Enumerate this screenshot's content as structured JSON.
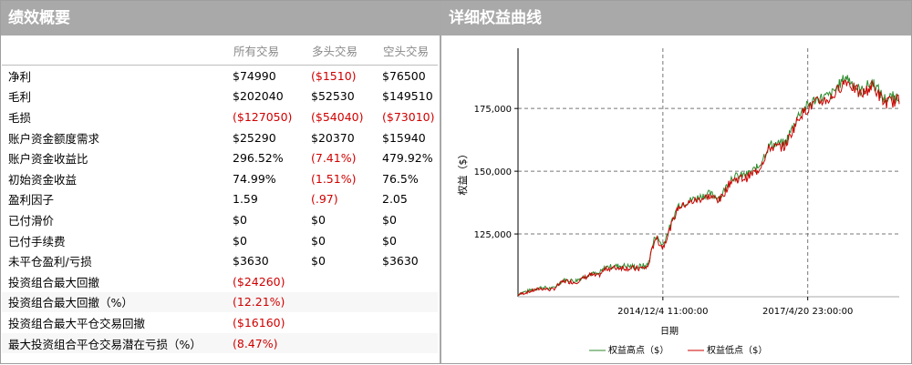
{
  "summary": {
    "title": "绩效概要",
    "columns": [
      "所有交易",
      "多头交易",
      "空头交易"
    ],
    "rows": [
      {
        "label": "净利",
        "values": [
          "$74990",
          "($1510)",
          "$76500"
        ]
      },
      {
        "label": "毛利",
        "values": [
          "$202040",
          "$52530",
          "$149510"
        ]
      },
      {
        "label": "毛损",
        "values": [
          "($127050)",
          "($54040)",
          "($73010)"
        ]
      },
      {
        "label": "账户资金额度需求",
        "values": [
          "$25290",
          "$20370",
          "$15940"
        ]
      },
      {
        "label": "账户资金收益比",
        "values": [
          "296.52%",
          "(7.41%)",
          "479.92%"
        ]
      },
      {
        "label": "初始资金收益",
        "values": [
          "74.99%",
          "(1.51%)",
          "76.5%"
        ]
      },
      {
        "label": "盈利因子",
        "values": [
          "1.59",
          "(.97)",
          "2.05"
        ]
      },
      {
        "label": "已付滑价",
        "values": [
          "$0",
          "$0",
          "$0"
        ]
      },
      {
        "label": "已付手续费",
        "values": [
          "$0",
          "$0",
          "$0"
        ]
      },
      {
        "label": "未平仓盈利/亏损",
        "values": [
          "$3630",
          "$0",
          "$3630"
        ]
      },
      {
        "label": "投资组合最大回撤",
        "values": [
          "($24260)",
          "",
          ""
        ]
      },
      {
        "label": "投资组合最大回撤（%）",
        "values": [
          "(12.21%)",
          "",
          ""
        ]
      },
      {
        "label": "投资组合最大平仓交易回撤",
        "values": [
          "($16160)",
          "",
          ""
        ]
      },
      {
        "label": "最大投资组合平仓交易潜在亏损（%）",
        "values": [
          "(8.47%)",
          "",
          ""
        ]
      }
    ]
  },
  "colors": {
    "negative": "#d00000",
    "header_bg": "#a9a9a9",
    "series_high": "#2e8b2e",
    "series_low": "#cc0000"
  },
  "chart_data": {
    "type": "line",
    "title": "详细权益曲线",
    "xlabel": "日期",
    "ylabel": "权益（$）",
    "x_ticks": [
      "2014/12/4 11:00:00",
      "2017/4/20 23:00:00"
    ],
    "y_ticks": [
      "125,000",
      "150,000",
      "175,000"
    ],
    "ylim": [
      100000,
      199000
    ],
    "grid": true,
    "legend_position": "bottom-center",
    "series": [
      {
        "name": "权益高点（$）",
        "color": "#2e8b2e"
      },
      {
        "name": "权益低点（$）",
        "color": "#cc0000"
      }
    ],
    "x_index": [
      0,
      6,
      9,
      12,
      15,
      19,
      21,
      23,
      27,
      31,
      34,
      36,
      38,
      42,
      46,
      50,
      53,
      56,
      60,
      63,
      66,
      70,
      74,
      78,
      82,
      86,
      90,
      93,
      96,
      100
    ],
    "values": [
      101000,
      103500,
      103000,
      106500,
      106000,
      109000,
      108500,
      111500,
      112000,
      111500,
      112000,
      124000,
      120000,
      136000,
      138500,
      140500,
      139000,
      147000,
      148000,
      151000,
      160000,
      160500,
      173000,
      178000,
      179500,
      187000,
      181000,
      185000,
      178000,
      179000
    ]
  }
}
